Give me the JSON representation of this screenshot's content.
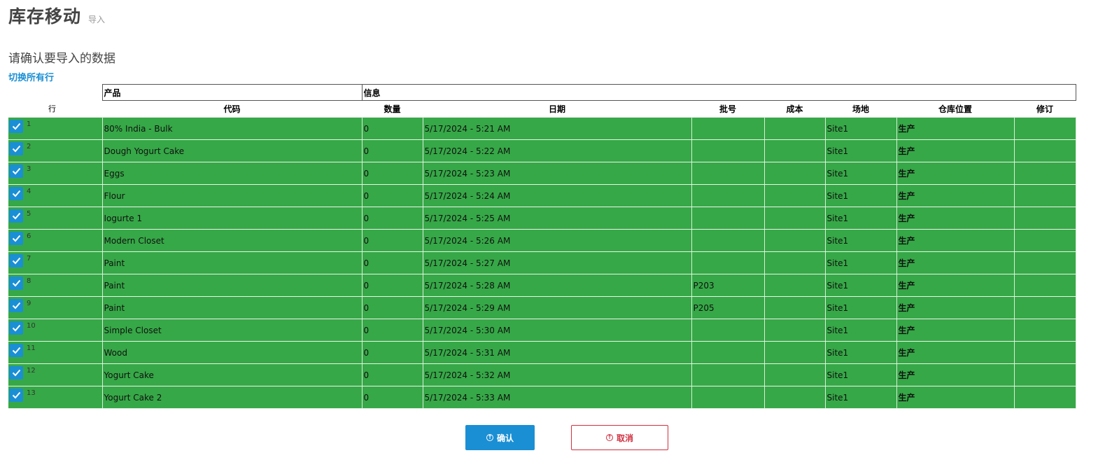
{
  "header": {
    "title": "库存移动",
    "subtitle": "导入"
  },
  "prompt": "请确认要导入的数据",
  "toggle_all": "切换所有行",
  "table": {
    "group_headers": {
      "product": "产品",
      "info": "信息"
    },
    "columns": {
      "row": "行",
      "code": "代码",
      "quantity": "数量",
      "date": "日期",
      "batch": "批号",
      "cost": "成本",
      "site": "场地",
      "location": "仓库位置",
      "revision": "修订"
    },
    "rows": [
      {
        "num": "1",
        "checked": true,
        "code": "80% India - Bulk",
        "quantity": "0",
        "date": "5/17/2024 - 5:21 AM",
        "batch": "",
        "cost": "",
        "site": "Site1",
        "location": "生产",
        "revision": ""
      },
      {
        "num": "2",
        "checked": true,
        "code": "Dough Yogurt Cake",
        "quantity": "0",
        "date": "5/17/2024 - 5:22 AM",
        "batch": "",
        "cost": "",
        "site": "Site1",
        "location": "生产",
        "revision": ""
      },
      {
        "num": "3",
        "checked": true,
        "code": "Eggs",
        "quantity": "0",
        "date": "5/17/2024 - 5:23 AM",
        "batch": "",
        "cost": "",
        "site": "Site1",
        "location": "生产",
        "revision": ""
      },
      {
        "num": "4",
        "checked": true,
        "code": "Flour",
        "quantity": "0",
        "date": "5/17/2024 - 5:24 AM",
        "batch": "",
        "cost": "",
        "site": "Site1",
        "location": "生产",
        "revision": ""
      },
      {
        "num": "5",
        "checked": true,
        "code": "Iogurte 1",
        "quantity": "0",
        "date": "5/17/2024 - 5:25 AM",
        "batch": "",
        "cost": "",
        "site": "Site1",
        "location": "生产",
        "revision": ""
      },
      {
        "num": "6",
        "checked": true,
        "code": "Modern Closet",
        "quantity": "0",
        "date": "5/17/2024 - 5:26 AM",
        "batch": "",
        "cost": "",
        "site": "Site1",
        "location": "生产",
        "revision": ""
      },
      {
        "num": "7",
        "checked": true,
        "code": "Paint",
        "quantity": "0",
        "date": "5/17/2024 - 5:27 AM",
        "batch": "",
        "cost": "",
        "site": "Site1",
        "location": "生产",
        "revision": ""
      },
      {
        "num": "8",
        "checked": true,
        "code": "Paint",
        "quantity": "0",
        "date": "5/17/2024 - 5:28 AM",
        "batch": "P203",
        "cost": "",
        "site": "Site1",
        "location": "生产",
        "revision": ""
      },
      {
        "num": "9",
        "checked": true,
        "code": "Paint",
        "quantity": "0",
        "date": "5/17/2024 - 5:29 AM",
        "batch": "P205",
        "cost": "",
        "site": "Site1",
        "location": "生产",
        "revision": ""
      },
      {
        "num": "10",
        "checked": true,
        "code": "Simple Closet",
        "quantity": "0",
        "date": "5/17/2024 - 5:30 AM",
        "batch": "",
        "cost": "",
        "site": "Site1",
        "location": "生产",
        "revision": ""
      },
      {
        "num": "11",
        "checked": true,
        "code": "Wood",
        "quantity": "0",
        "date": "5/17/2024 - 5:31 AM",
        "batch": "",
        "cost": "",
        "site": "Site1",
        "location": "生产",
        "revision": ""
      },
      {
        "num": "12",
        "checked": true,
        "code": "Yogurt Cake",
        "quantity": "0",
        "date": "5/17/2024 - 5:32 AM",
        "batch": "",
        "cost": "",
        "site": "Site1",
        "location": "生产",
        "revision": ""
      },
      {
        "num": "13",
        "checked": true,
        "code": "Yogurt Cake 2",
        "quantity": "0",
        "date": "5/17/2024 - 5:33 AM",
        "batch": "",
        "cost": "",
        "site": "Site1",
        "location": "生产",
        "revision": ""
      }
    ]
  },
  "actions": {
    "confirm": "确认",
    "cancel": "取消"
  },
  "colors": {
    "row_selected": "#36a847",
    "primary": "#1a8fd4",
    "danger": "#d03040"
  },
  "icons": {
    "checkbox": "check-icon",
    "confirm": "circle-arrow-icon",
    "cancel": "circle-arrow-icon"
  }
}
